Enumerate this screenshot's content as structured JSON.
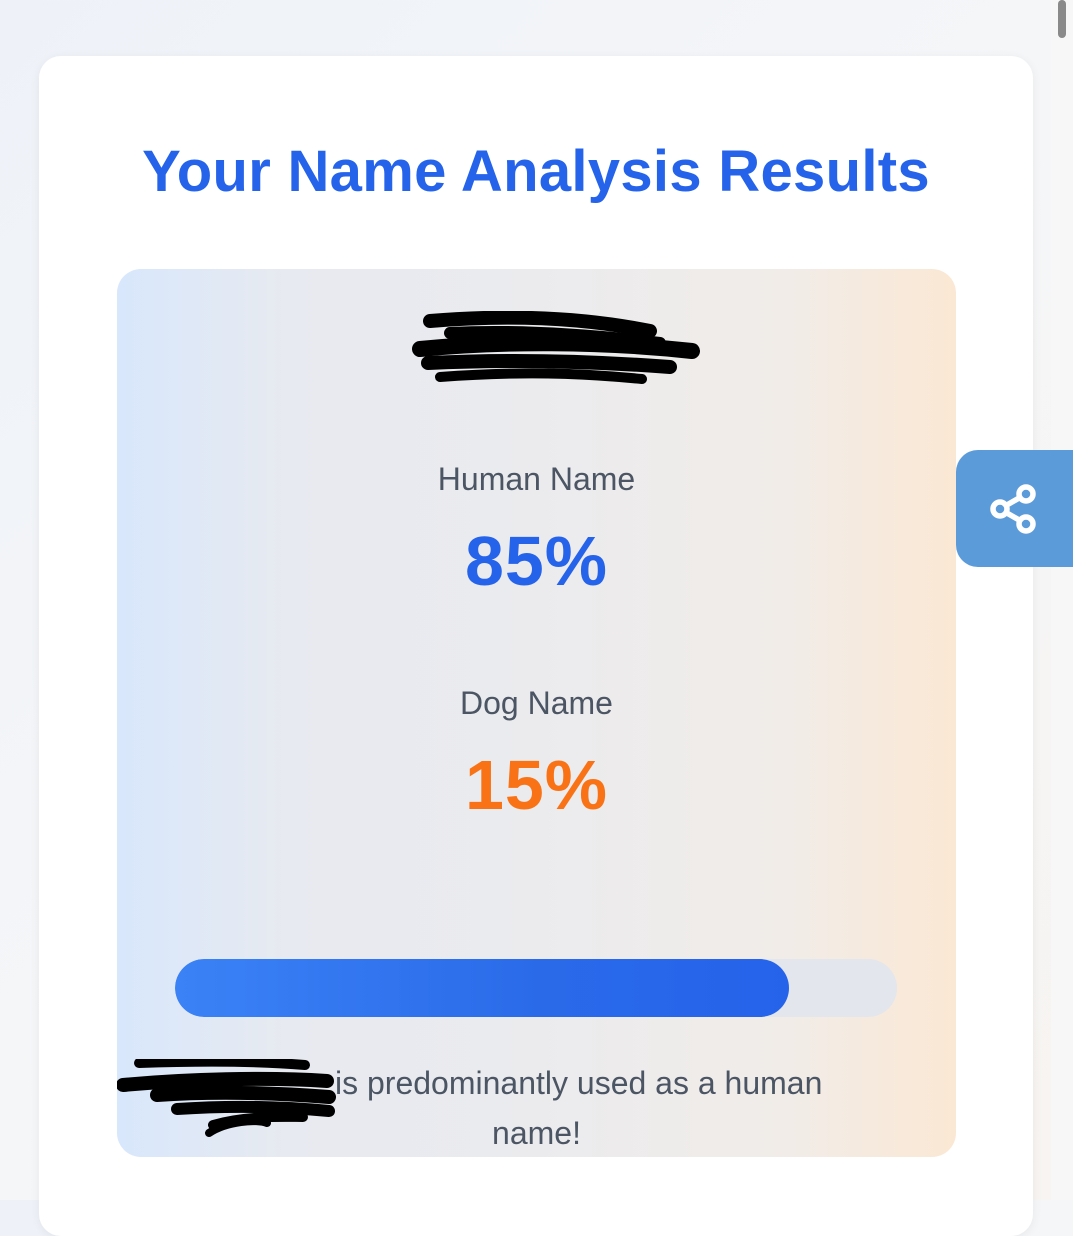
{
  "title": "Your Name Analysis Results",
  "results": {
    "human": {
      "label": "Human Name",
      "percent_text": "85%",
      "percent": 85,
      "color": "#2563eb"
    },
    "dog": {
      "label": "Dog Name",
      "percent_text": "15%",
      "percent": 15,
      "color": "#f97316"
    }
  },
  "progress": {
    "fill_fraction": 0.85
  },
  "summary": {
    "line1": "is predominantly used as a human",
    "line2": "name!"
  },
  "share": {
    "icon": "share-icon"
  },
  "colors": {
    "accent": "#2563eb",
    "share_button": "#5b9bd9"
  }
}
